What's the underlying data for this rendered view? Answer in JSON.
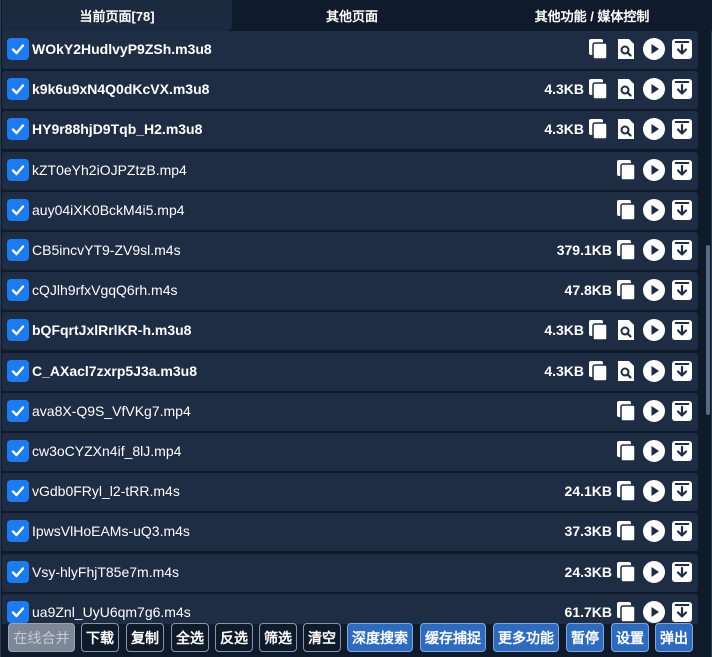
{
  "tabs": [
    {
      "label": "当前页面[78]"
    },
    {
      "label": "其他页面"
    },
    {
      "label": "其他功能 / 媒体控制"
    }
  ],
  "items": [
    {
      "name": "WOkY2HudlvyP9ZSh.m3u8",
      "size": "",
      "bold": true,
      "search": true
    },
    {
      "name": "k9k6u9xN4Q0dKcVX.m3u8",
      "size": "4.3KB",
      "bold": true,
      "search": true
    },
    {
      "name": "HY9r88hjD9Tqb_H2.m3u8",
      "size": "4.3KB",
      "bold": true,
      "search": true
    },
    {
      "name": "kZT0eYh2iOJPZtzB.mp4",
      "size": "",
      "bold": false,
      "search": false
    },
    {
      "name": "auy04iXK0BckM4i5.mp4",
      "size": "",
      "bold": false,
      "search": false
    },
    {
      "name": "CB5incvYT9-ZV9sl.m4s",
      "size": "379.1KB",
      "bold": false,
      "search": false
    },
    {
      "name": "cQJlh9rfxVgqQ6rh.m4s",
      "size": "47.8KB",
      "bold": false,
      "search": false
    },
    {
      "name": "bQFqrtJxlRrlKR-h.m3u8",
      "size": "4.3KB",
      "bold": true,
      "search": true
    },
    {
      "name": "C_AXacl7zxrp5J3a.m3u8",
      "size": "4.3KB",
      "bold": true,
      "search": true
    },
    {
      "name": "ava8X-Q9S_VfVKg7.mp4",
      "size": "",
      "bold": false,
      "search": false
    },
    {
      "name": "cw3oCYZXn4if_8lJ.mp4",
      "size": "",
      "bold": false,
      "search": false
    },
    {
      "name": "vGdb0FRyl_l2-tRR.m4s",
      "size": "24.1KB",
      "bold": false,
      "search": false
    },
    {
      "name": "IpwsVlHoEAMs-uQ3.m4s",
      "size": "37.3KB",
      "bold": false,
      "search": false
    },
    {
      "name": "Vsy-hlyFhjT85e7m.m4s",
      "size": "24.3KB",
      "bold": false,
      "search": false
    },
    {
      "name": "ua9Znl_UyU6qm7g6.m4s",
      "size": "61.7KB",
      "bold": false,
      "search": false
    }
  ],
  "toolbar": {
    "merge_online": "在线合并",
    "download": "下载",
    "copy": "复制",
    "select_all": "全选",
    "invert": "反选",
    "filter": "筛选",
    "clear": "清空",
    "deep_search": "深度搜索",
    "cache_capture": "缓存捕捉",
    "more": "更多功能",
    "pause": "暂停",
    "settings": "设置",
    "popup": "弹出"
  },
  "colors": {
    "checkbox": "#1d7bf0",
    "row_bg": "#1f2d44",
    "page_bg": "#0f1b2b",
    "blue_button": "#2f6bbd",
    "disabled_button": "#7d8795"
  }
}
